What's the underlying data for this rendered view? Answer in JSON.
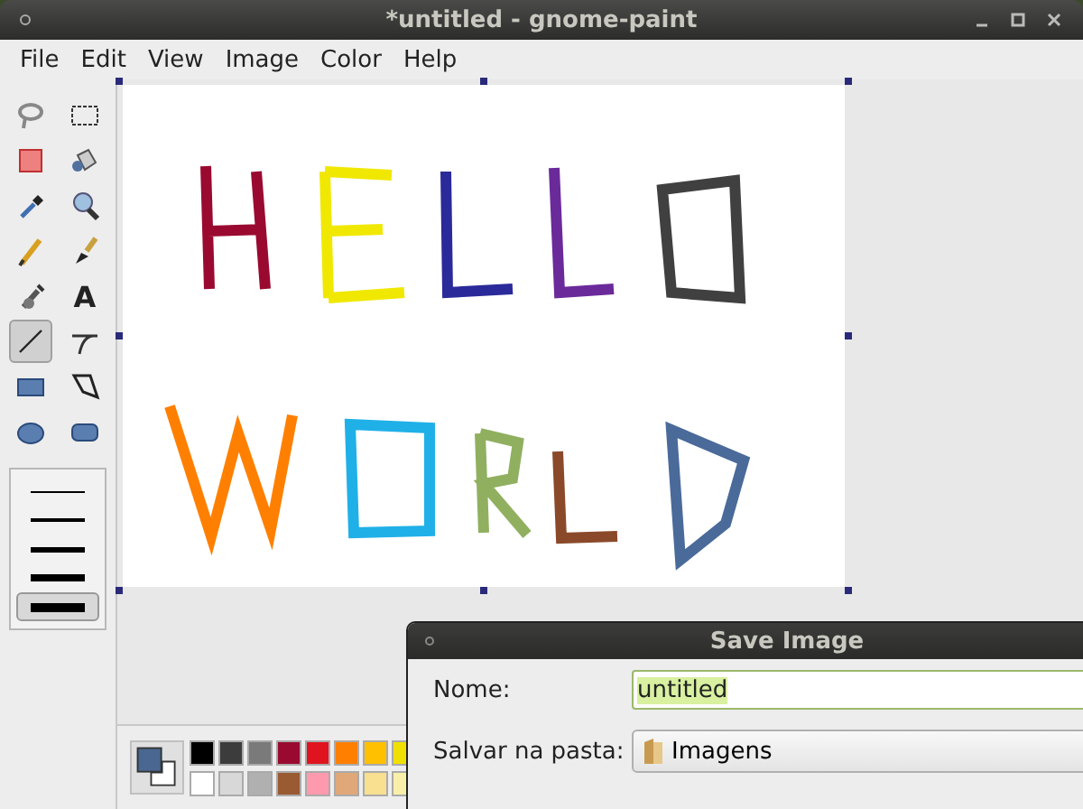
{
  "window": {
    "title": "*untitled - gnome-paint"
  },
  "menu": [
    "File",
    "Edit",
    "View",
    "Image",
    "Color",
    "Help"
  ],
  "tools": [
    {
      "kind": "lasso",
      "selected": false
    },
    {
      "kind": "rect-select",
      "selected": false
    },
    {
      "kind": "eraser",
      "selected": false
    },
    {
      "kind": "fill",
      "selected": false
    },
    {
      "kind": "picker",
      "selected": false
    },
    {
      "kind": "zoom",
      "selected": false
    },
    {
      "kind": "pencil",
      "selected": false
    },
    {
      "kind": "brush",
      "selected": false
    },
    {
      "kind": "airbrush",
      "selected": false
    },
    {
      "kind": "text",
      "label": "A",
      "selected": false
    },
    {
      "kind": "line",
      "selected": true
    },
    {
      "kind": "curve",
      "selected": false
    },
    {
      "kind": "rectangle",
      "selected": false
    },
    {
      "kind": "polygon",
      "selected": false
    },
    {
      "kind": "ellipse",
      "selected": false
    },
    {
      "kind": "rounded-rect",
      "selected": false
    }
  ],
  "line_widths": [
    {
      "selected": false
    },
    {
      "selected": false
    },
    {
      "selected": false
    },
    {
      "selected": false
    },
    {
      "selected": true
    }
  ],
  "current_colors": [
    {
      "kind": "primary",
      "color": "#4a6791"
    },
    {
      "kind": "secondary",
      "color": "#ffffff"
    }
  ],
  "palette": [
    {
      "color": "#000000"
    },
    {
      "color": "#3c3c3c"
    },
    {
      "color": "#7a7a7a"
    },
    {
      "color": "#9a0a30"
    },
    {
      "color": "#e0141e"
    },
    {
      "color": "#ff7f00"
    },
    {
      "color": "#ffc000"
    },
    {
      "color": "#f0e000"
    },
    {
      "color": "#ffffff"
    },
    {
      "color": "#d8d8d8"
    },
    {
      "color": "#b0b0b0"
    },
    {
      "color": "#9a5a32"
    },
    {
      "color": "#ff9aae"
    },
    {
      "color": "#e0a878"
    },
    {
      "color": "#f8e090"
    },
    {
      "color": "#f8f0a8"
    }
  ],
  "dialog": {
    "title": "Save Image",
    "name_label": "Nome:",
    "name_value": "untitled",
    "folder_label": "Salvar na pasta:",
    "folder_value": "Imagens"
  }
}
